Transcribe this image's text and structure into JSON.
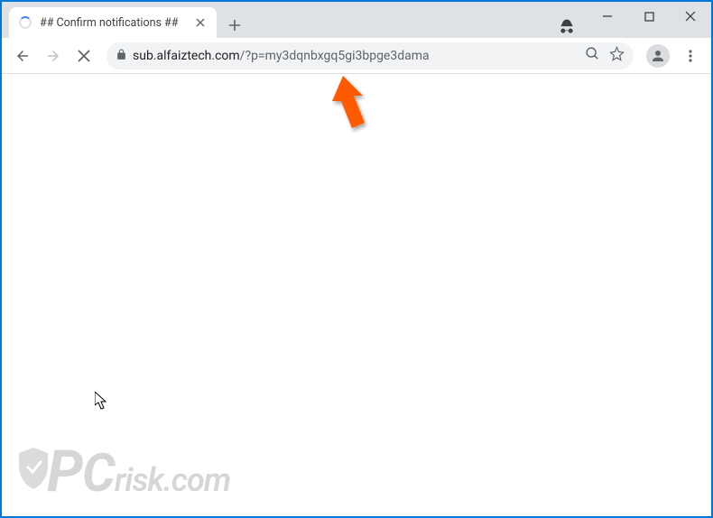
{
  "window": {
    "tab_title": "## Confirm notifications ##"
  },
  "address_bar": {
    "host": "sub.alfaiztech.com",
    "path": "/?p=my3dqnbxgq5gi3bpge3dama"
  },
  "watermark": {
    "text_part1": "P",
    "text_part2": "C",
    "text_part3": "risk.com"
  }
}
